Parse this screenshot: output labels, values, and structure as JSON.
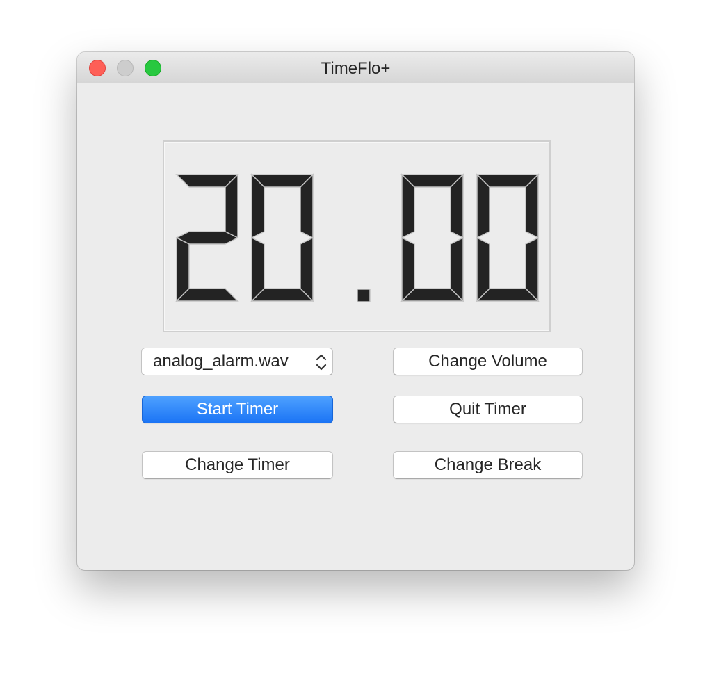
{
  "window": {
    "title": "TimeFlo+"
  },
  "timer": {
    "display": "20.00"
  },
  "controls": {
    "sound_select": {
      "selected": "analog_alarm.wav",
      "icon": "up-down-chevron-icon"
    },
    "change_volume_label": "Change Volume",
    "start_timer_label": "Start Timer",
    "quit_timer_label": "Quit Timer",
    "change_timer_label": "Change Timer",
    "change_break_label": "Change Break"
  },
  "colors": {
    "primary_button": "#1b74f5",
    "close": "#fe5f57",
    "minimize": "#cdcdcd",
    "maximize": "#28c840",
    "lcd_segment": "#232323"
  }
}
